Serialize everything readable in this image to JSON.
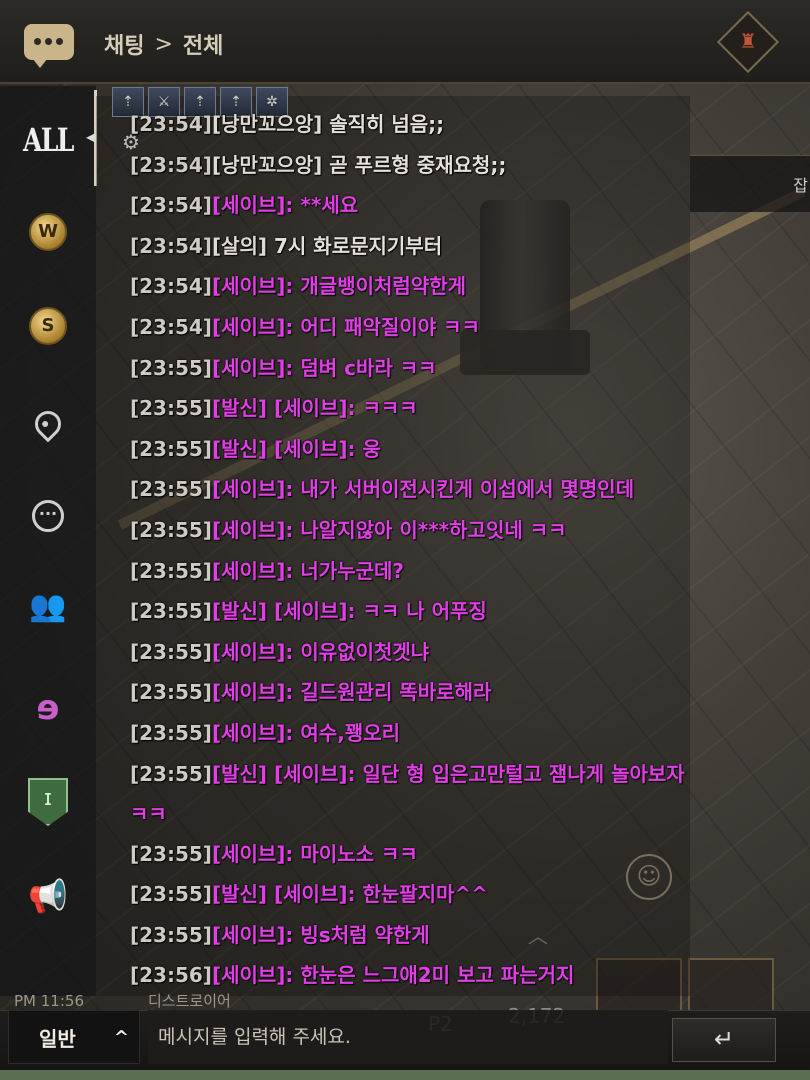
{
  "header": {
    "crumb_root": "채팅",
    "crumb_sep": ">",
    "crumb_current": "전체"
  },
  "sidebar": {
    "items": [
      {
        "label": "ALL",
        "icon": "all-channel",
        "active": true
      },
      {
        "label": "W",
        "icon": "world-coin-icon"
      },
      {
        "label": "S",
        "icon": "server-coin-icon"
      },
      {
        "label": "",
        "icon": "location-pin-icon"
      },
      {
        "label": "···",
        "icon": "speech-bubble-icon"
      },
      {
        "label": "",
        "icon": "party-people-icon"
      },
      {
        "label": "",
        "icon": "whisper-ear-icon"
      },
      {
        "label": "",
        "icon": "guild-shield-icon"
      },
      {
        "label": "",
        "icon": "megaphone-icon"
      }
    ]
  },
  "chat": {
    "messages": [
      {
        "ts": "[23:54]",
        "sender": "[낭만꼬으앙]",
        "text": " 솔직히 넘음;;",
        "style": "normal"
      },
      {
        "ts": "[23:54]",
        "sender": "[낭만꼬으앙]",
        "text": " 곧 푸르형 중재요청;;",
        "style": "normal"
      },
      {
        "ts": "[23:54]",
        "sender": "[세이브]:",
        "text": " **세요",
        "style": "magenta"
      },
      {
        "ts": "[23:54]",
        "sender": "[살의]",
        "text": " 7시 화로문지기부터",
        "style": "normal"
      },
      {
        "ts": "[23:54]",
        "sender": "[세이브]:",
        "text": " 개글뱅이처럼약한게",
        "style": "magenta"
      },
      {
        "ts": "[23:54]",
        "sender": "[세이브]:",
        "text": " 어디 패악질이야 ㅋㅋ",
        "style": "magenta"
      },
      {
        "ts": "[23:55]",
        "sender": "[세이브]:",
        "text": " 덤벼 c바라 ㅋㅋ",
        "style": "magenta"
      },
      {
        "ts": "[23:55]",
        "sender": "[발신] [세이브]:",
        "text": " ㅋㅋㅋ",
        "style": "magenta"
      },
      {
        "ts": "[23:55]",
        "sender": "[발신] [세이브]:",
        "text": " 웅",
        "style": "magenta"
      },
      {
        "ts": "[23:55]",
        "sender": "[세이브]:",
        "text": " 내가 서버이전시킨게 이섭에서 몇명인데",
        "style": "magenta"
      },
      {
        "ts": "[23:55]",
        "sender": "[세이브]:",
        "text": " 나알지않아 이***하고잇네 ㅋㅋ",
        "style": "magenta"
      },
      {
        "ts": "[23:55]",
        "sender": "[세이브]:",
        "text": " 너가누군데?",
        "style": "magenta"
      },
      {
        "ts": "[23:55]",
        "sender": "[발신] [세이브]:",
        "text": " ㅋㅋ 나 어푸징",
        "style": "magenta"
      },
      {
        "ts": "[23:55]",
        "sender": "[세이브]:",
        "text": " 이유없이첫겟냐",
        "style": "magenta"
      },
      {
        "ts": "[23:55]",
        "sender": "[세이브]:",
        "text": " 길드원관리 똑바로해라",
        "style": "magenta"
      },
      {
        "ts": "[23:55]",
        "sender": "[세이브]:",
        "text": " 여수,꽹오리",
        "style": "magenta"
      },
      {
        "ts": "[23:55]",
        "sender": "[발신] [세이브]:",
        "text": " 일단 형 입은고만털고 잼나게 놀아보자ㅋㅋ",
        "style": "magenta",
        "wrap": true
      },
      {
        "ts": "[23:55]",
        "sender": "[세이브]:",
        "text": " 마이노소 ㅋㅋ",
        "style": "magenta"
      },
      {
        "ts": "[23:55]",
        "sender": "[발신] [세이브]:",
        "text": " 한눈팔지마^^",
        "style": "magenta"
      },
      {
        "ts": "[23:55]",
        "sender": "[세이브]:",
        "text": " 빙s처럼 약한게",
        "style": "magenta"
      },
      {
        "ts": "[23:56]",
        "sender": "[세이브]:",
        "text": " 한눈은 느그애2미 보고 파는거지",
        "style": "magenta"
      }
    ]
  },
  "bottom": {
    "time_text": "PM 11:56",
    "target_text": "디스트로이어",
    "channel_label": "일반",
    "channel_chevron": "^",
    "input_placeholder": "메시지를 입력해 주세요.",
    "send_label": "↵",
    "hud_p2": "P2",
    "hud_count": "2,172"
  },
  "right_tab_label": "잡",
  "colors": {
    "whisper": "#e23de6",
    "normal_text": "#e6e1d8",
    "header_bg": "#2b2a27",
    "accent_gold": "#cab58a"
  }
}
